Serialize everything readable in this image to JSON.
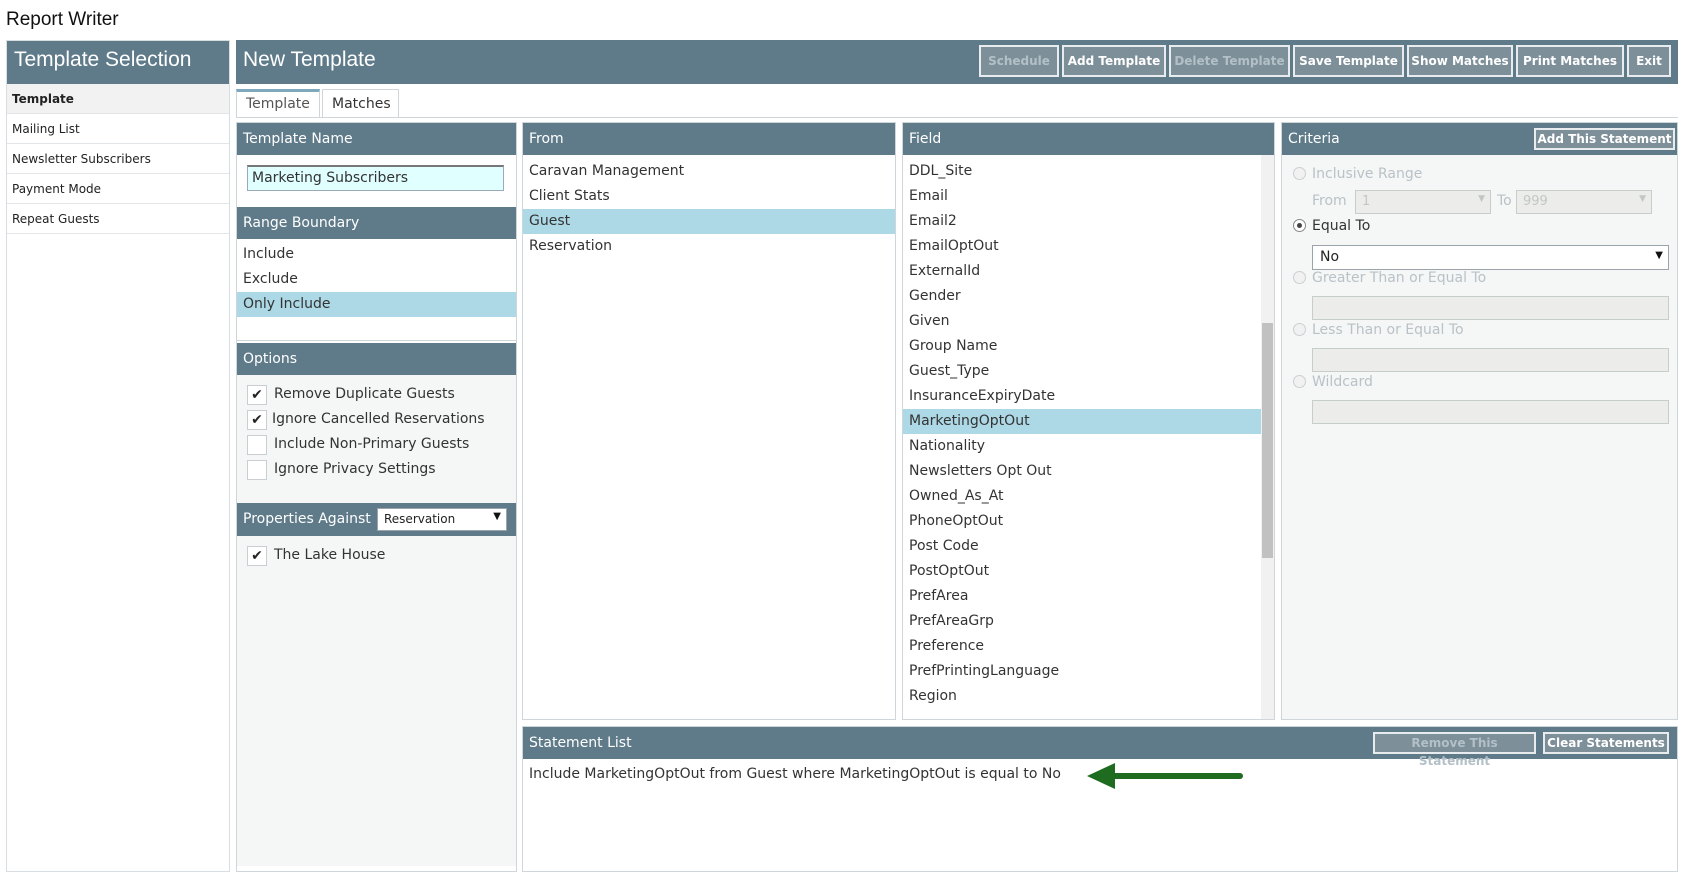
{
  "app": {
    "title": "Report Writer"
  },
  "sidebar": {
    "title": "Template Selection",
    "items": [
      {
        "label": "Template",
        "active": true
      },
      {
        "label": "Mailing List"
      },
      {
        "label": "Newsletter Subscribers"
      },
      {
        "label": "Payment Mode"
      },
      {
        "label": "Repeat Guests"
      }
    ]
  },
  "header": {
    "title": "New Template",
    "buttons": {
      "schedule": "Schedule",
      "add_template": "Add Template",
      "delete_template": "Delete Template",
      "save_template": "Save Template",
      "show_matches": "Show Matches",
      "print_matches": "Print Matches",
      "exit": "Exit"
    }
  },
  "tabs": {
    "template": "Template",
    "matches": "Matches"
  },
  "template_name": {
    "title": "Template Name",
    "value": "Marketing Subscribers"
  },
  "range_boundary": {
    "title": "Range Boundary",
    "items": [
      "Include",
      "Exclude",
      "Only Include"
    ],
    "selected": "Only Include"
  },
  "options": {
    "title": "Options",
    "items": [
      {
        "label": "Remove Duplicate Guests",
        "checked": true
      },
      {
        "label": "Ignore Cancelled Reservations",
        "checked": true
      },
      {
        "label": "Include Non-Primary Guests",
        "checked": false
      },
      {
        "label": "Ignore Privacy Settings",
        "checked": false
      }
    ]
  },
  "properties": {
    "title": "Properties Against",
    "select_value": "Reservation",
    "items": [
      {
        "label": "The Lake House",
        "checked": true
      }
    ]
  },
  "from": {
    "title": "From",
    "items": [
      "Caravan Management",
      "Client Stats",
      "Guest",
      "Reservation"
    ],
    "selected": "Guest"
  },
  "field": {
    "title": "Field",
    "items": [
      "DDL_Site",
      "Email",
      "Email2",
      "EmailOptOut",
      "ExternalId",
      "Gender",
      "Given",
      "Group Name",
      "Guest_Type",
      "InsuranceExpiryDate",
      "MarketingOptOut",
      "Nationality",
      "Newsletters Opt Out",
      "Owned_As_At",
      "PhoneOptOut",
      "Post Code",
      "PostOptOut",
      "PrefArea",
      "PrefAreaGrp",
      "Preference",
      "PrefPrintingLanguage",
      "Region"
    ],
    "selected": "MarketingOptOut"
  },
  "criteria": {
    "title": "Criteria",
    "add_button": "Add This Statement",
    "inclusive_range": "Inclusive Range",
    "from_label": "From",
    "from_value": "1",
    "to_label": "To",
    "to_value": "999",
    "equal_to": "Equal To",
    "equal_to_value": "No",
    "greater_than": "Greater Than or Equal To",
    "less_than": "Less Than or Equal To",
    "wildcard": "Wildcard"
  },
  "statement_list": {
    "title": "Statement List",
    "remove_button": "Remove This Statement",
    "clear_button": "Clear Statements",
    "statements": [
      "Include MarketingOptOut from Guest where MarketingOptOut is equal to No"
    ]
  },
  "colors": {
    "header": "#5f7b8a",
    "selected": "#add8e6",
    "button": "#7d8f99",
    "arrow": "#1f6b1f"
  }
}
